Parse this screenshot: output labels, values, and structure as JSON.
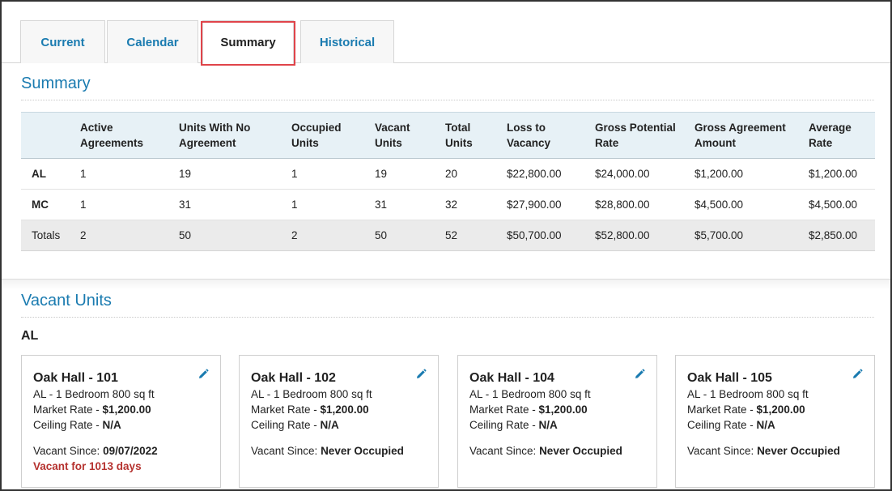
{
  "tabs": [
    {
      "label": "Current"
    },
    {
      "label": "Calendar"
    },
    {
      "label": "Summary",
      "active": true
    },
    {
      "label": "Historical"
    }
  ],
  "summary": {
    "title": "Summary",
    "columns": [
      "",
      "Active\nAgreements",
      "Units With No\nAgreement",
      "Occupied\nUnits",
      "Vacant\nUnits",
      "Total\nUnits",
      "Loss to\nVacancy",
      "Gross Potential\nRate",
      "Gross Agreement\nAmount",
      "Average\nRate"
    ],
    "rows": [
      [
        "AL",
        "1",
        "19",
        "1",
        "19",
        "20",
        "$22,800.00",
        "$24,000.00",
        "$1,200.00",
        "$1,200.00"
      ],
      [
        "MC",
        "1",
        "31",
        "1",
        "31",
        "32",
        "$27,900.00",
        "$28,800.00",
        "$4,500.00",
        "$4,500.00"
      ],
      [
        "Totals",
        "2",
        "50",
        "2",
        "50",
        "52",
        "$50,700.00",
        "$52,800.00",
        "$5,700.00",
        "$2,850.00"
      ]
    ]
  },
  "vacant": {
    "title": "Vacant Units",
    "group": "AL",
    "cards": [
      {
        "title": "Oak Hall - 101",
        "type": "AL - 1 Bedroom 800 sq ft",
        "market_label": "Market Rate - ",
        "market_value": "$1,200.00",
        "ceiling_label": "Ceiling Rate - ",
        "ceiling_value": "N/A",
        "since_label": "Vacant Since: ",
        "since_value": "09/07/2022",
        "vacant_for": "Vacant for 1013 days"
      },
      {
        "title": "Oak Hall - 102",
        "type": "AL - 1 Bedroom 800 sq ft",
        "market_label": "Market Rate - ",
        "market_value": "$1,200.00",
        "ceiling_label": "Ceiling Rate - ",
        "ceiling_value": "N/A",
        "since_label": "Vacant Since: ",
        "since_value": "Never Occupied",
        "vacant_for": ""
      },
      {
        "title": "Oak Hall - 104",
        "type": "AL - 1 Bedroom 800 sq ft",
        "market_label": "Market Rate - ",
        "market_value": "$1,200.00",
        "ceiling_label": "Ceiling Rate - ",
        "ceiling_value": "N/A",
        "since_label": "Vacant Since: ",
        "since_value": "Never Occupied",
        "vacant_for": ""
      },
      {
        "title": "Oak Hall - 105",
        "type": "AL - 1 Bedroom 800 sq ft",
        "market_label": "Market Rate - ",
        "market_value": "$1,200.00",
        "ceiling_label": "Ceiling Rate - ",
        "ceiling_value": "N/A",
        "since_label": "Vacant Since: ",
        "since_value": "Never Occupied",
        "vacant_for": ""
      }
    ]
  },
  "icons": {
    "edit": "pencil-icon"
  },
  "colors": {
    "accent": "#1a7bb0",
    "highlight": "#e0444a",
    "warning": "#b5322f",
    "header_bg": "#e7f1f6"
  }
}
